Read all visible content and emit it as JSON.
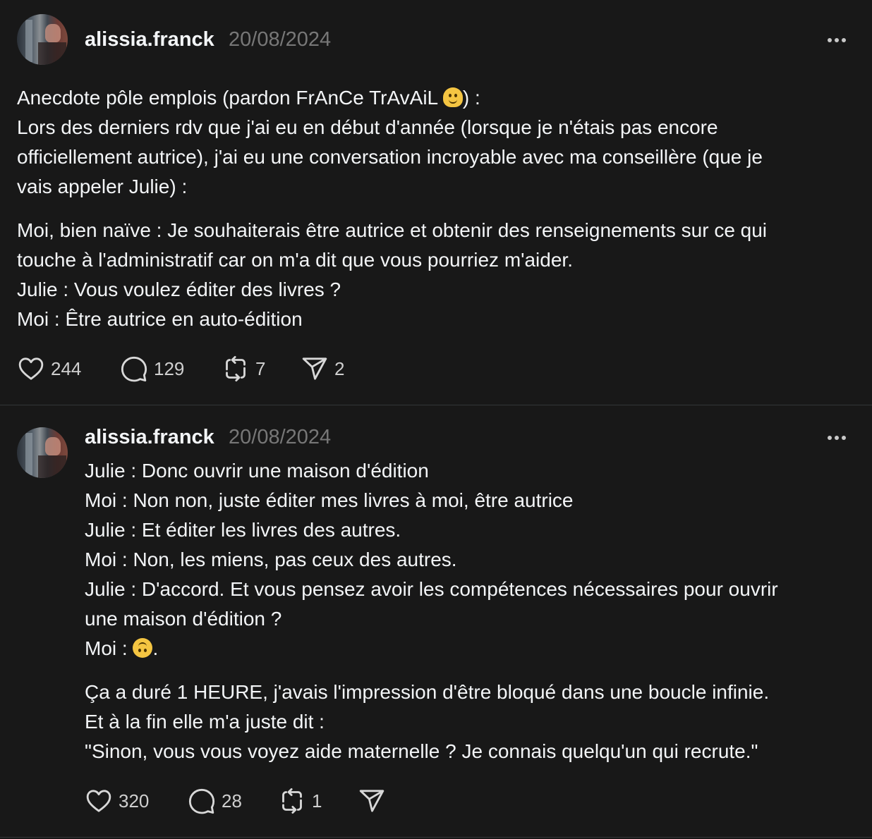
{
  "posts": [
    {
      "username": "alissia.franck",
      "date": "20/08/2024",
      "paragraph1": {
        "line1_before_emoji": "Anecdote pôle emplois (pardon FrAnCe TrAvAiL ",
        "line1_after_emoji": ") :",
        "line2": "Lors des derniers rdv que j'ai eu en début d'année (lorsque je n'étais pas encore",
        "line3": "officiellement autrice), j'ai eu une conversation incroyable avec ma conseillère (que je",
        "line4": "vais appeler Julie) :"
      },
      "paragraph2": {
        "line1": "Moi, bien naïve : Je souhaiterais être autrice et obtenir des renseignements sur ce qui",
        "line2": "touche à l'administratif car on m'a dit que vous pourriez m'aider.",
        "line3": "Julie : Vous voulez éditer des livres ?",
        "line4": "Moi : Être autrice en auto-édition"
      },
      "actions": {
        "likes": "244",
        "replies": "129",
        "reposts": "7",
        "shares": "2"
      }
    },
    {
      "username": "alissia.franck",
      "date": "20/08/2024",
      "paragraph1": {
        "line1": "Julie : Donc ouvrir une maison d'édition",
        "line2": "Moi : Non non, juste éditer mes livres à moi, être autrice",
        "line3": "Julie : Et éditer les livres des autres.",
        "line4": "Moi : Non, les miens, pas ceux des autres.",
        "line5": "Julie : D'accord. Et vous pensez avoir les compétences nécessaires pour ouvrir",
        "line6": "une maison d'édition ?",
        "line7_before_emoji": "Moi : ",
        "line7_after_emoji": "."
      },
      "paragraph2": {
        "line1": "Ça a duré 1 HEURE, j'avais l'impression d'être bloqué dans une boucle infinie.",
        "line2": "Et à la fin elle m'a juste dit :",
        "line3": "\"Sinon, vous vous voyez aide maternelle ? Je connais quelqu'un qui recrute.\""
      },
      "actions": {
        "likes": "320",
        "replies": "28",
        "reposts": "1"
      }
    }
  ],
  "icons": {
    "like": "heart-icon",
    "reply": "comment-bubble-icon",
    "repost": "repost-arrows-icon",
    "share": "send-paper-plane-icon",
    "more": "more-horizontal-icon",
    "emoji1": "melting-face-emoji",
    "emoji2": "upside-down-face-emoji"
  },
  "colors": {
    "background": "#181818",
    "text": "#f3f5f7",
    "muted": "#777777",
    "divider": "#333638"
  }
}
